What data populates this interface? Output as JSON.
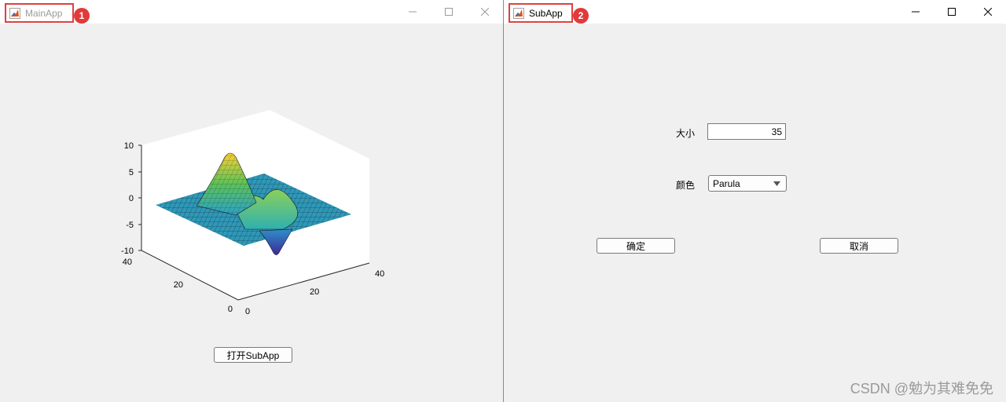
{
  "main_window": {
    "title": "MainApp",
    "badge": "1",
    "open_button_label": "打开SubApp",
    "plot": {
      "z_ticks": [
        "10",
        "5",
        "0",
        "-5",
        "-10"
      ],
      "y_ticks": [
        "40",
        "20",
        "0"
      ],
      "x_ticks": [
        "0",
        "20",
        "40"
      ],
      "colormap": "parula",
      "surface": "peaks"
    }
  },
  "sub_window": {
    "title": "SubApp",
    "badge": "2",
    "size_label": "大小",
    "size_value": "35",
    "color_label": "颜色",
    "color_selected": "Parula",
    "ok_label": "确定",
    "cancel_label": "取消"
  },
  "watermark": "CSDN @勉为其难免免",
  "colors": {
    "highlight": "#e04040",
    "badge": "#e03a3a"
  }
}
